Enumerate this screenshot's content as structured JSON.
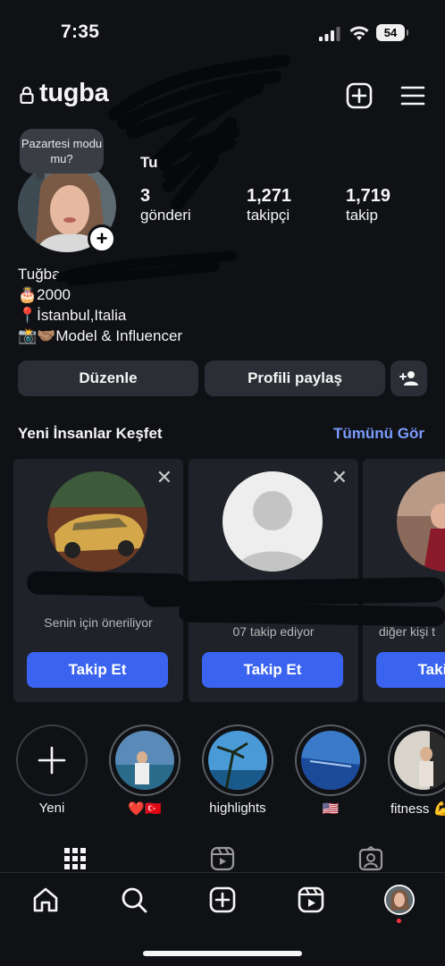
{
  "status_bar": {
    "time": "7:35",
    "battery": "54"
  },
  "header": {
    "username": "tugba"
  },
  "profile": {
    "note": "Pazartesi modu mu?",
    "display_name": "Tu",
    "stats": [
      {
        "value": "3",
        "label": "gönderi"
      },
      {
        "value": "1,271",
        "label": "takipçi"
      },
      {
        "value": "1,719",
        "label": "takip"
      }
    ],
    "bio": [
      "Tuğba",
      "🎂2000",
      "📍İstanbul,Italia",
      "📸🤝🏽Model & Influencer"
    ]
  },
  "actions": {
    "edit": "Düzenle",
    "share": "Profili paylaş"
  },
  "discover": {
    "title": "Yeni İnsanlar Keşfet",
    "see_all": "Tümünü Gör",
    "cards": [
      {
        "subtitle": "Senin için öneriliyor",
        "button": "Takip Et"
      },
      {
        "subtitle": "07 takip ediyor",
        "button": "Takip Et"
      },
      {
        "subtitle": "diğer kişi t",
        "button": "Takip Et"
      }
    ]
  },
  "highlights": [
    {
      "label": "Yeni"
    },
    {
      "label": "❤️🇹🇷"
    },
    {
      "label": "highlights"
    },
    {
      "label": "🇺🇸"
    },
    {
      "label": "fitness 💪"
    }
  ],
  "colors": {
    "background": "#0f1115",
    "accent": "#3a63f0",
    "link": "#7b9cff",
    "card": "#1f2228"
  }
}
